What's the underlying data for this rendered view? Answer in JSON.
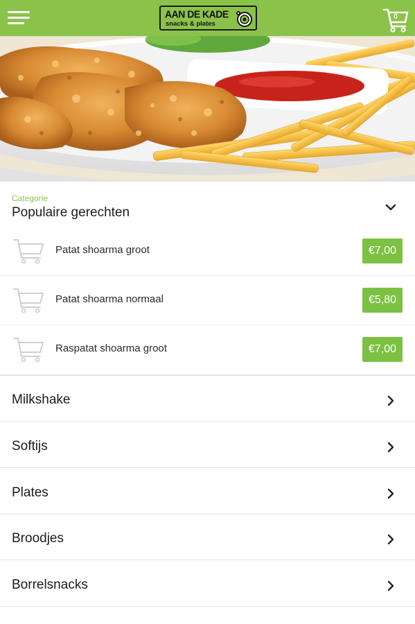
{
  "header": {
    "menu_icon": "hamburger-menu-icon",
    "logo": {
      "line1": "AAN DE KADE",
      "line2": "snacks & plates"
    },
    "cart": {
      "icon": "shopping-cart-icon",
      "count": "0"
    }
  },
  "hero": {
    "description_icon": "food-photo"
  },
  "category": {
    "caption": "Categorie",
    "title": "Populaire gerechten",
    "expanded": true,
    "products": [
      {
        "name": "Patat shoarma groot",
        "price": "€7,00"
      },
      {
        "name": "Patat shoarma normaal",
        "price": "€5,80"
      },
      {
        "name": "Raspatat shoarma groot",
        "price": "€7,00"
      }
    ]
  },
  "categories": [
    {
      "label": "Milkshake"
    },
    {
      "label": "Softijs"
    },
    {
      "label": "Plates"
    },
    {
      "label": "Broodjes"
    },
    {
      "label": "Borrelsnacks"
    }
  ],
  "colors": {
    "brand_green": "#8bc34a",
    "price_green": "#7cc142"
  }
}
